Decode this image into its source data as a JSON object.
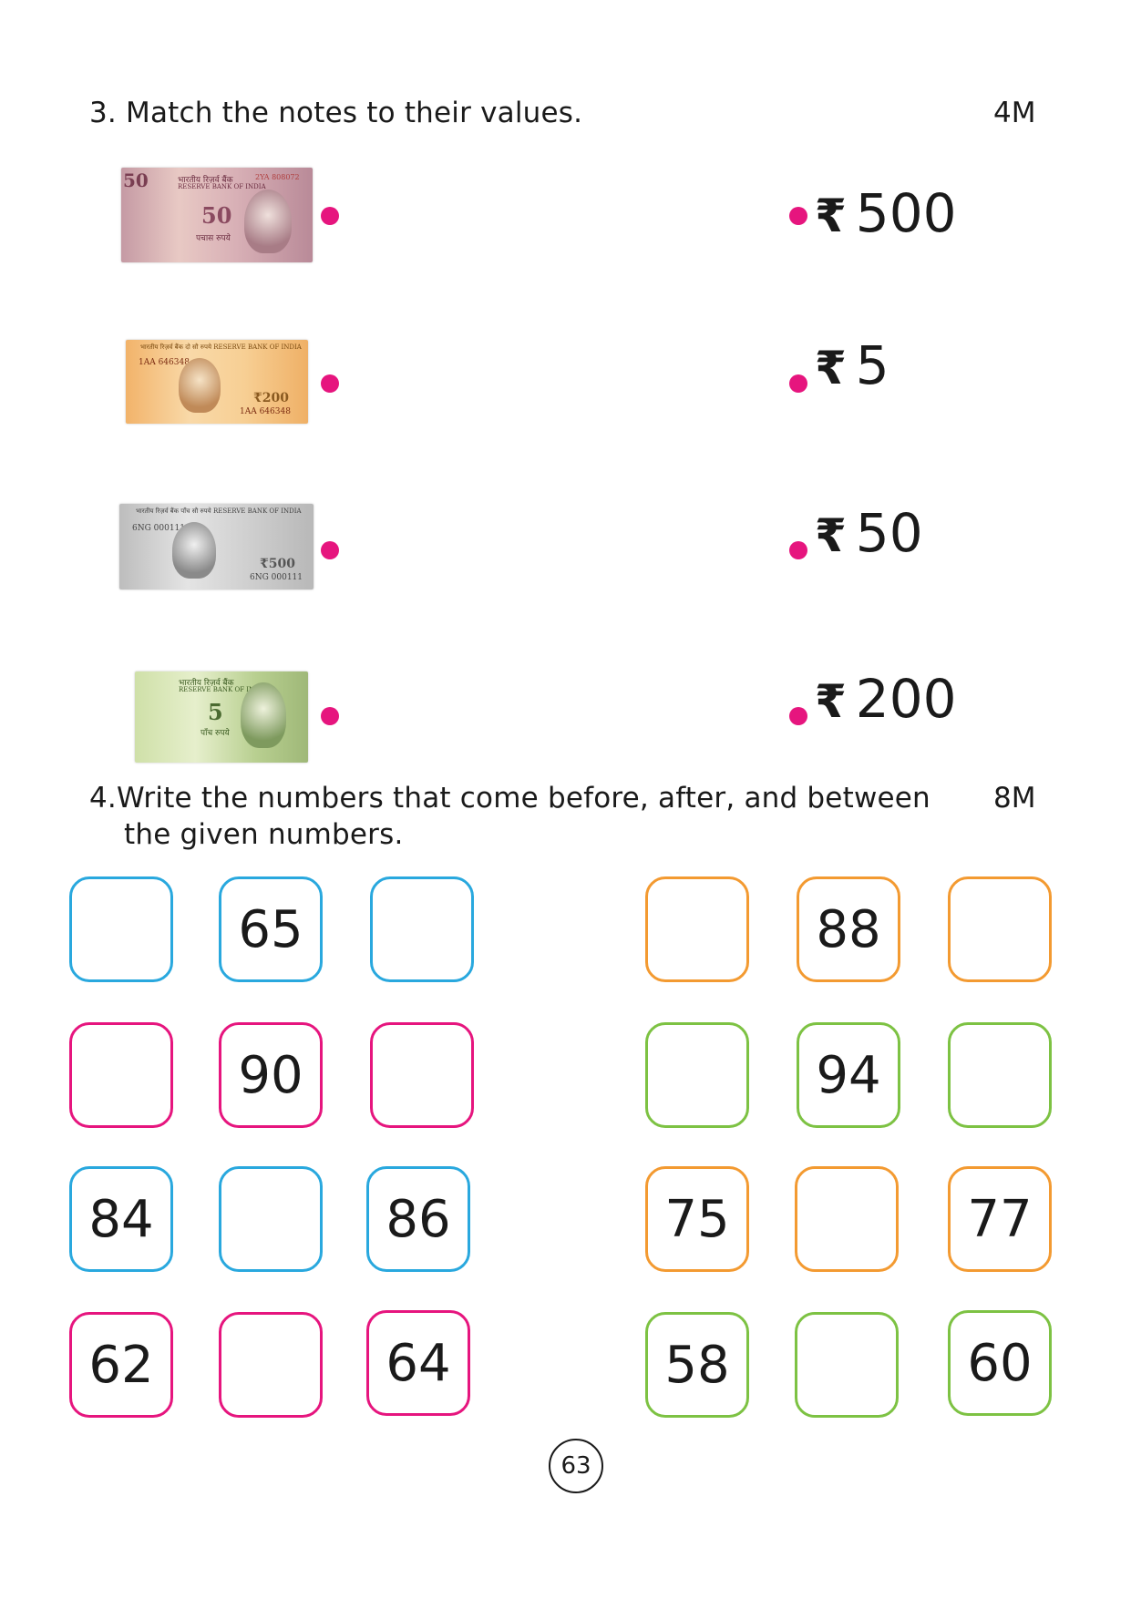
{
  "q3": {
    "text": "3. Match the notes to their values.",
    "marks": "4M"
  },
  "notes": [
    {
      "name": "fifty-rupee-note",
      "denomination": "50",
      "header": "भारतीय रिज़र्व बैंक",
      "bank": "RESERVE BANK OF INDIA",
      "serial": "2YA 808072",
      "word": "पचास रुपये"
    },
    {
      "name": "two-hundred-rupee-note",
      "denomination": "₹200",
      "header": "भारतीय रिज़र्व बैंक  दो सौ रुपये  RESERVE BANK OF INDIA",
      "bank": "",
      "serial": "1AA 646348",
      "word": ""
    },
    {
      "name": "five-hundred-rupee-note",
      "denomination": "₹500",
      "header": "भारतीय रिज़र्व बैंक  पाँच सौ रुपये  RESERVE BANK OF INDIA",
      "bank": "",
      "serial": "6NG 000111",
      "word": ""
    },
    {
      "name": "five-rupee-note",
      "denomination": "5",
      "header": "भारतीय रिज़र्व बैंक",
      "bank": "RESERVE BANK OF INDIA",
      "serial": "",
      "word": "पाँच रुपये"
    }
  ],
  "values": [
    {
      "symbol": "₹",
      "amount": "500"
    },
    {
      "symbol": "₹",
      "amount": "5"
    },
    {
      "symbol": "₹",
      "amount": "50"
    },
    {
      "symbol": "₹",
      "amount": "200"
    }
  ],
  "q4": {
    "text_line1": "4.Write the numbers that come before, after, and between",
    "text_line2": "the given numbers.",
    "marks": "8M"
  },
  "grid": {
    "left": [
      [
        "",
        "65",
        ""
      ],
      [
        "",
        "90",
        ""
      ],
      [
        "84",
        "",
        "86"
      ],
      [
        "62",
        "",
        "64"
      ]
    ],
    "right": [
      [
        "",
        "88",
        ""
      ],
      [
        "",
        "94",
        ""
      ],
      [
        "75",
        "",
        "77"
      ],
      [
        "58",
        "",
        "60"
      ]
    ]
  },
  "colors": {
    "blue": "#29a8de",
    "pink": "#e6157e",
    "orange": "#f39a31",
    "green": "#7dc243"
  },
  "page_number": "63"
}
